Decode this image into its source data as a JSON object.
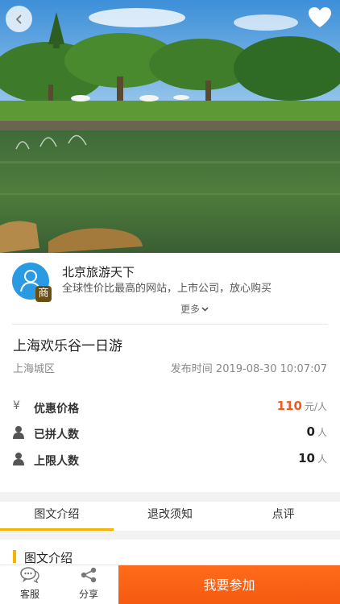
{
  "merchant": {
    "name": "北京旅游天下",
    "badge": "商",
    "description": "全球性价比最高的网站，上市公司，放心购买",
    "more_label": "更多"
  },
  "product": {
    "title": "上海欢乐谷一日游",
    "area": "上海城区",
    "publish_time": "发布时间 2019-08-30 10:07:07"
  },
  "info": {
    "price": {
      "icon": "yen-icon",
      "symbol": "¥",
      "label": "优惠价格",
      "value": "110",
      "unit": "元/人"
    },
    "joined": {
      "icon": "person-icon",
      "label": "已拼人数",
      "value": "0",
      "unit": "人"
    },
    "limit": {
      "icon": "person-icon",
      "label": "上限人数",
      "value": "10",
      "unit": "人"
    }
  },
  "tabs": [
    "图文介绍",
    "退改须知",
    "点评"
  ],
  "section": {
    "title": "图文介绍"
  },
  "bottom_bar": {
    "service_label": "客服",
    "share_label": "分享",
    "join_label": "我要参加"
  },
  "colors": {
    "accent": "#f5b400",
    "cta": "#f55a10",
    "price": "#f05a1f",
    "avatar": "#2a9ae3"
  }
}
